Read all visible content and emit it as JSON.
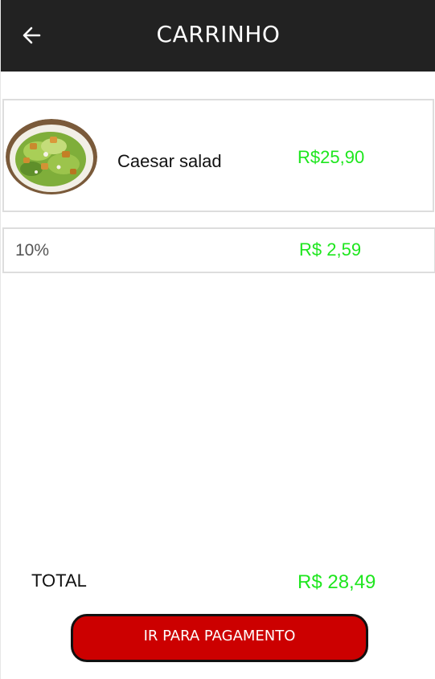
{
  "header": {
    "title": "CARRINHO",
    "back_icon": "arrow-left-icon",
    "bg_color": "#222222"
  },
  "cart": {
    "items": [
      {
        "name": "Caesar salad",
        "price": "R$25,90",
        "image": "caesar-salad-image"
      }
    ],
    "fee": {
      "label": "10%",
      "value": "R$ 2,59"
    }
  },
  "summary": {
    "total_label": "TOTAL",
    "total_value": "R$ 28,49"
  },
  "actions": {
    "pay_label": "IR PARA PAGAMENTO",
    "pay_color": "#cc0000"
  },
  "colors": {
    "price_green": "#1ee61e"
  }
}
